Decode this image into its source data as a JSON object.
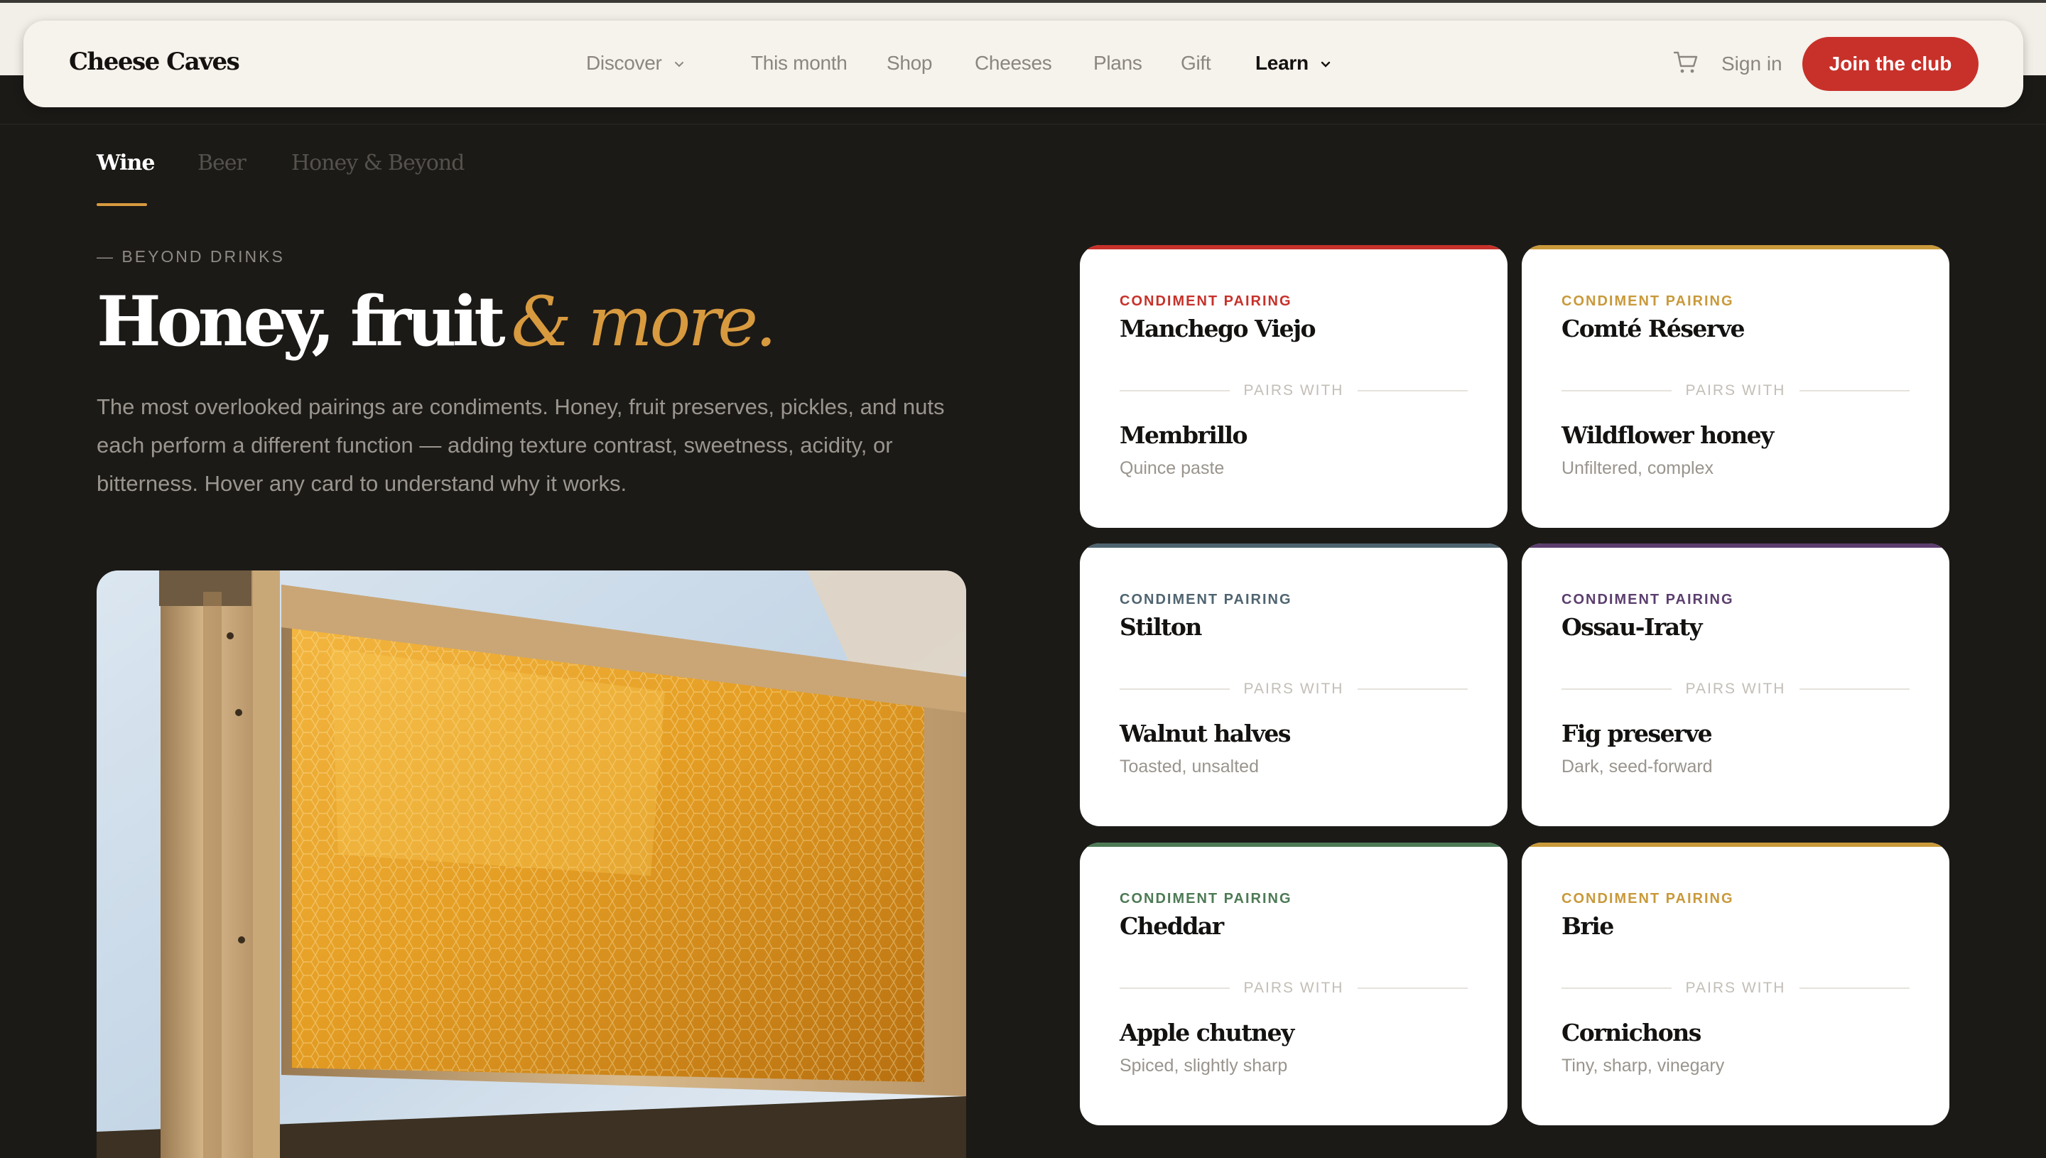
{
  "nav": {
    "logo": "Cheese Caves",
    "links": [
      {
        "label": "Discover",
        "has_chevron": true
      },
      {
        "label": "This month"
      },
      {
        "label": "Shop"
      },
      {
        "label": "Cheeses"
      },
      {
        "label": "Plans"
      },
      {
        "label": "Gift"
      },
      {
        "label": "Learn",
        "has_chevron": true,
        "active": true
      }
    ],
    "cart_icon": "cart-icon",
    "sign_in": "Sign in",
    "cta": "Join the club"
  },
  "tabs": [
    {
      "label": "Wine",
      "active": true
    },
    {
      "label": "Beer"
    },
    {
      "label": "Honey & Beyond"
    }
  ],
  "hero": {
    "eyebrow": "— BEYOND DRINKS",
    "headline_main": "Honey, fruit",
    "headline_accent": "& more.",
    "body": "The most overlooked pairings are condiments. Honey, fruit preserves, pickles, and nuts each perform a different function — adding texture contrast, sweetness, acidity, or bitterness. Hover any card to understand why it works."
  },
  "pairs_with_label": "PAIRS WITH",
  "cards": [
    {
      "kicker": "CONDIMENT PAIRING",
      "cheese": "Manchego Viejo",
      "pair": "Membrillo",
      "desc": "Quince paste",
      "accent": "#c7312a"
    },
    {
      "kicker": "CONDIMENT PAIRING",
      "cheese": "Comté Réserve",
      "pair": "Wildflower honey",
      "desc": "Unfiltered, complex",
      "accent": "#c9993a"
    },
    {
      "kicker": "CONDIMENT PAIRING",
      "cheese": "Stilton",
      "pair": "Walnut halves",
      "desc": "Toasted, unsalted",
      "accent": "#4f6470"
    },
    {
      "kicker": "CONDIMENT PAIRING",
      "cheese": "Ossau-Iraty",
      "pair": "Fig preserve",
      "desc": "Dark, seed-forward",
      "accent": "#5b3e6e"
    },
    {
      "kicker": "CONDIMENT PAIRING",
      "cheese": "Cheddar",
      "pair": "Apple chutney",
      "desc": "Spiced, slightly sharp",
      "accent": "#4d7a55"
    },
    {
      "kicker": "CONDIMENT PAIRING",
      "cheese": "Brie",
      "pair": "Cornichons",
      "desc": "Tiny, sharp, vinegary",
      "accent": "#c9993a"
    }
  ],
  "colors": {
    "background": "#1c1a17",
    "brand_red": "#c7312a",
    "gold": "#d89a3f",
    "nav_bg": "#f6f2ec"
  }
}
